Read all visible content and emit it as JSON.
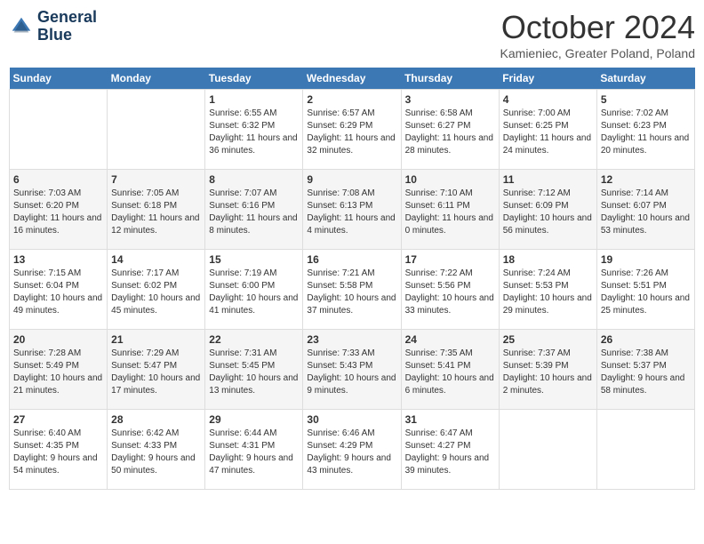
{
  "logo": {
    "line1": "General",
    "line2": "Blue"
  },
  "title": "October 2024",
  "subtitle": "Kamieniec, Greater Poland, Poland",
  "days_header": [
    "Sunday",
    "Monday",
    "Tuesday",
    "Wednesday",
    "Thursday",
    "Friday",
    "Saturday"
  ],
  "weeks": [
    [
      {
        "day": "",
        "sunrise": "",
        "sunset": "",
        "daylight": ""
      },
      {
        "day": "",
        "sunrise": "",
        "sunset": "",
        "daylight": ""
      },
      {
        "day": "1",
        "sunrise": "Sunrise: 6:55 AM",
        "sunset": "Sunset: 6:32 PM",
        "daylight": "Daylight: 11 hours and 36 minutes."
      },
      {
        "day": "2",
        "sunrise": "Sunrise: 6:57 AM",
        "sunset": "Sunset: 6:29 PM",
        "daylight": "Daylight: 11 hours and 32 minutes."
      },
      {
        "day": "3",
        "sunrise": "Sunrise: 6:58 AM",
        "sunset": "Sunset: 6:27 PM",
        "daylight": "Daylight: 11 hours and 28 minutes."
      },
      {
        "day": "4",
        "sunrise": "Sunrise: 7:00 AM",
        "sunset": "Sunset: 6:25 PM",
        "daylight": "Daylight: 11 hours and 24 minutes."
      },
      {
        "day": "5",
        "sunrise": "Sunrise: 7:02 AM",
        "sunset": "Sunset: 6:23 PM",
        "daylight": "Daylight: 11 hours and 20 minutes."
      }
    ],
    [
      {
        "day": "6",
        "sunrise": "Sunrise: 7:03 AM",
        "sunset": "Sunset: 6:20 PM",
        "daylight": "Daylight: 11 hours and 16 minutes."
      },
      {
        "day": "7",
        "sunrise": "Sunrise: 7:05 AM",
        "sunset": "Sunset: 6:18 PM",
        "daylight": "Daylight: 11 hours and 12 minutes."
      },
      {
        "day": "8",
        "sunrise": "Sunrise: 7:07 AM",
        "sunset": "Sunset: 6:16 PM",
        "daylight": "Daylight: 11 hours and 8 minutes."
      },
      {
        "day": "9",
        "sunrise": "Sunrise: 7:08 AM",
        "sunset": "Sunset: 6:13 PM",
        "daylight": "Daylight: 11 hours and 4 minutes."
      },
      {
        "day": "10",
        "sunrise": "Sunrise: 7:10 AM",
        "sunset": "Sunset: 6:11 PM",
        "daylight": "Daylight: 11 hours and 0 minutes."
      },
      {
        "day": "11",
        "sunrise": "Sunrise: 7:12 AM",
        "sunset": "Sunset: 6:09 PM",
        "daylight": "Daylight: 10 hours and 56 minutes."
      },
      {
        "day": "12",
        "sunrise": "Sunrise: 7:14 AM",
        "sunset": "Sunset: 6:07 PM",
        "daylight": "Daylight: 10 hours and 53 minutes."
      }
    ],
    [
      {
        "day": "13",
        "sunrise": "Sunrise: 7:15 AM",
        "sunset": "Sunset: 6:04 PM",
        "daylight": "Daylight: 10 hours and 49 minutes."
      },
      {
        "day": "14",
        "sunrise": "Sunrise: 7:17 AM",
        "sunset": "Sunset: 6:02 PM",
        "daylight": "Daylight: 10 hours and 45 minutes."
      },
      {
        "day": "15",
        "sunrise": "Sunrise: 7:19 AM",
        "sunset": "Sunset: 6:00 PM",
        "daylight": "Daylight: 10 hours and 41 minutes."
      },
      {
        "day": "16",
        "sunrise": "Sunrise: 7:21 AM",
        "sunset": "Sunset: 5:58 PM",
        "daylight": "Daylight: 10 hours and 37 minutes."
      },
      {
        "day": "17",
        "sunrise": "Sunrise: 7:22 AM",
        "sunset": "Sunset: 5:56 PM",
        "daylight": "Daylight: 10 hours and 33 minutes."
      },
      {
        "day": "18",
        "sunrise": "Sunrise: 7:24 AM",
        "sunset": "Sunset: 5:53 PM",
        "daylight": "Daylight: 10 hours and 29 minutes."
      },
      {
        "day": "19",
        "sunrise": "Sunrise: 7:26 AM",
        "sunset": "Sunset: 5:51 PM",
        "daylight": "Daylight: 10 hours and 25 minutes."
      }
    ],
    [
      {
        "day": "20",
        "sunrise": "Sunrise: 7:28 AM",
        "sunset": "Sunset: 5:49 PM",
        "daylight": "Daylight: 10 hours and 21 minutes."
      },
      {
        "day": "21",
        "sunrise": "Sunrise: 7:29 AM",
        "sunset": "Sunset: 5:47 PM",
        "daylight": "Daylight: 10 hours and 17 minutes."
      },
      {
        "day": "22",
        "sunrise": "Sunrise: 7:31 AM",
        "sunset": "Sunset: 5:45 PM",
        "daylight": "Daylight: 10 hours and 13 minutes."
      },
      {
        "day": "23",
        "sunrise": "Sunrise: 7:33 AM",
        "sunset": "Sunset: 5:43 PM",
        "daylight": "Daylight: 10 hours and 9 minutes."
      },
      {
        "day": "24",
        "sunrise": "Sunrise: 7:35 AM",
        "sunset": "Sunset: 5:41 PM",
        "daylight": "Daylight: 10 hours and 6 minutes."
      },
      {
        "day": "25",
        "sunrise": "Sunrise: 7:37 AM",
        "sunset": "Sunset: 5:39 PM",
        "daylight": "Daylight: 10 hours and 2 minutes."
      },
      {
        "day": "26",
        "sunrise": "Sunrise: 7:38 AM",
        "sunset": "Sunset: 5:37 PM",
        "daylight": "Daylight: 9 hours and 58 minutes."
      }
    ],
    [
      {
        "day": "27",
        "sunrise": "Sunrise: 6:40 AM",
        "sunset": "Sunset: 4:35 PM",
        "daylight": "Daylight: 9 hours and 54 minutes."
      },
      {
        "day": "28",
        "sunrise": "Sunrise: 6:42 AM",
        "sunset": "Sunset: 4:33 PM",
        "daylight": "Daylight: 9 hours and 50 minutes."
      },
      {
        "day": "29",
        "sunrise": "Sunrise: 6:44 AM",
        "sunset": "Sunset: 4:31 PM",
        "daylight": "Daylight: 9 hours and 47 minutes."
      },
      {
        "day": "30",
        "sunrise": "Sunrise: 6:46 AM",
        "sunset": "Sunset: 4:29 PM",
        "daylight": "Daylight: 9 hours and 43 minutes."
      },
      {
        "day": "31",
        "sunrise": "Sunrise: 6:47 AM",
        "sunset": "Sunset: 4:27 PM",
        "daylight": "Daylight: 9 hours and 39 minutes."
      },
      {
        "day": "",
        "sunrise": "",
        "sunset": "",
        "daylight": ""
      },
      {
        "day": "",
        "sunrise": "",
        "sunset": "",
        "daylight": ""
      }
    ]
  ]
}
